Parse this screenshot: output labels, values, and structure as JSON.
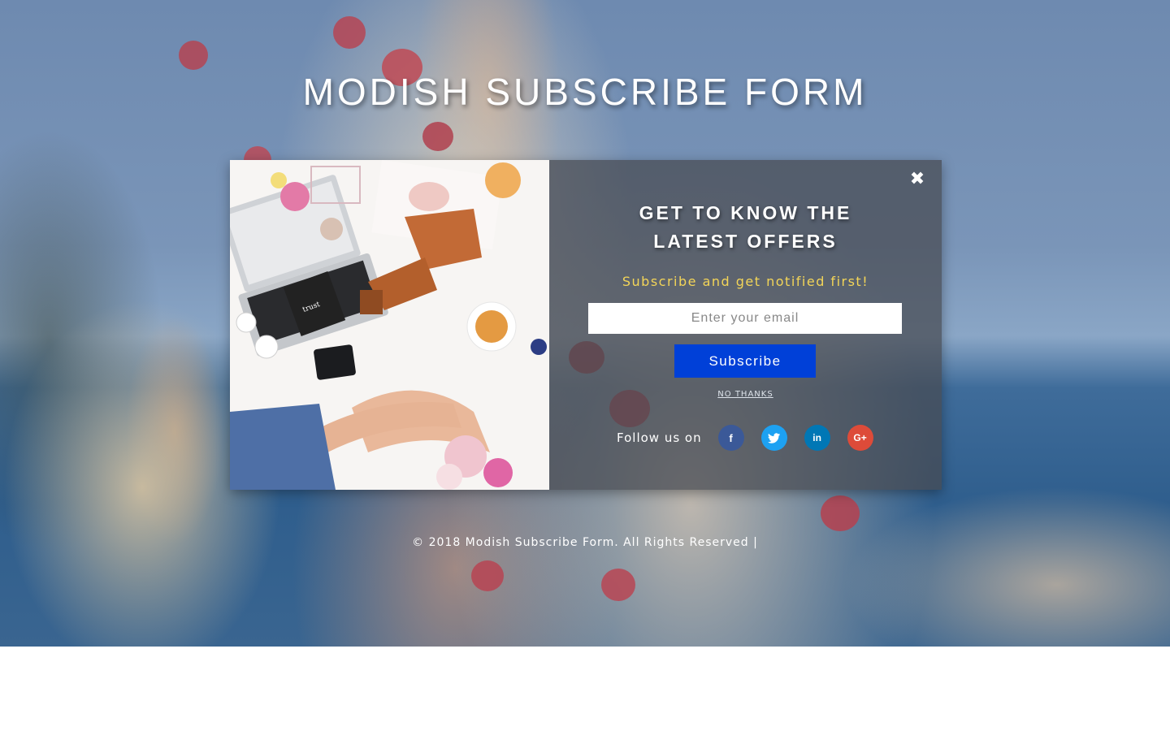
{
  "page": {
    "title": "MODISH SUBSCRIBE FORM",
    "footer": "© 2018 Modish Subscribe Form. All Rights Reserved |"
  },
  "modal": {
    "close_icon": "close-icon",
    "heading_line1": "GET TO KNOW THE",
    "heading_line2": "LATEST OFFERS",
    "subheading": "Subscribe and get notified first!",
    "email_placeholder": "Enter your email",
    "email_value": "",
    "subscribe_label": "Subscribe",
    "no_thanks_label": "NO THANKS",
    "follow_label": "Follow us on",
    "social": [
      {
        "name": "facebook-icon",
        "glyph": "f",
        "color": "#3b5998"
      },
      {
        "name": "twitter-icon",
        "glyph": "t",
        "color": "#1da1f2"
      },
      {
        "name": "linkedin-icon",
        "glyph": "in",
        "color": "#0077b5"
      },
      {
        "name": "google-plus-icon",
        "glyph": "G+",
        "color": "#dd4b39"
      }
    ]
  },
  "colors": {
    "subscribe_button": "#0040d8",
    "subheading": "#f3d558",
    "panel_overlay": "rgba(70,74,80,0.72)"
  }
}
